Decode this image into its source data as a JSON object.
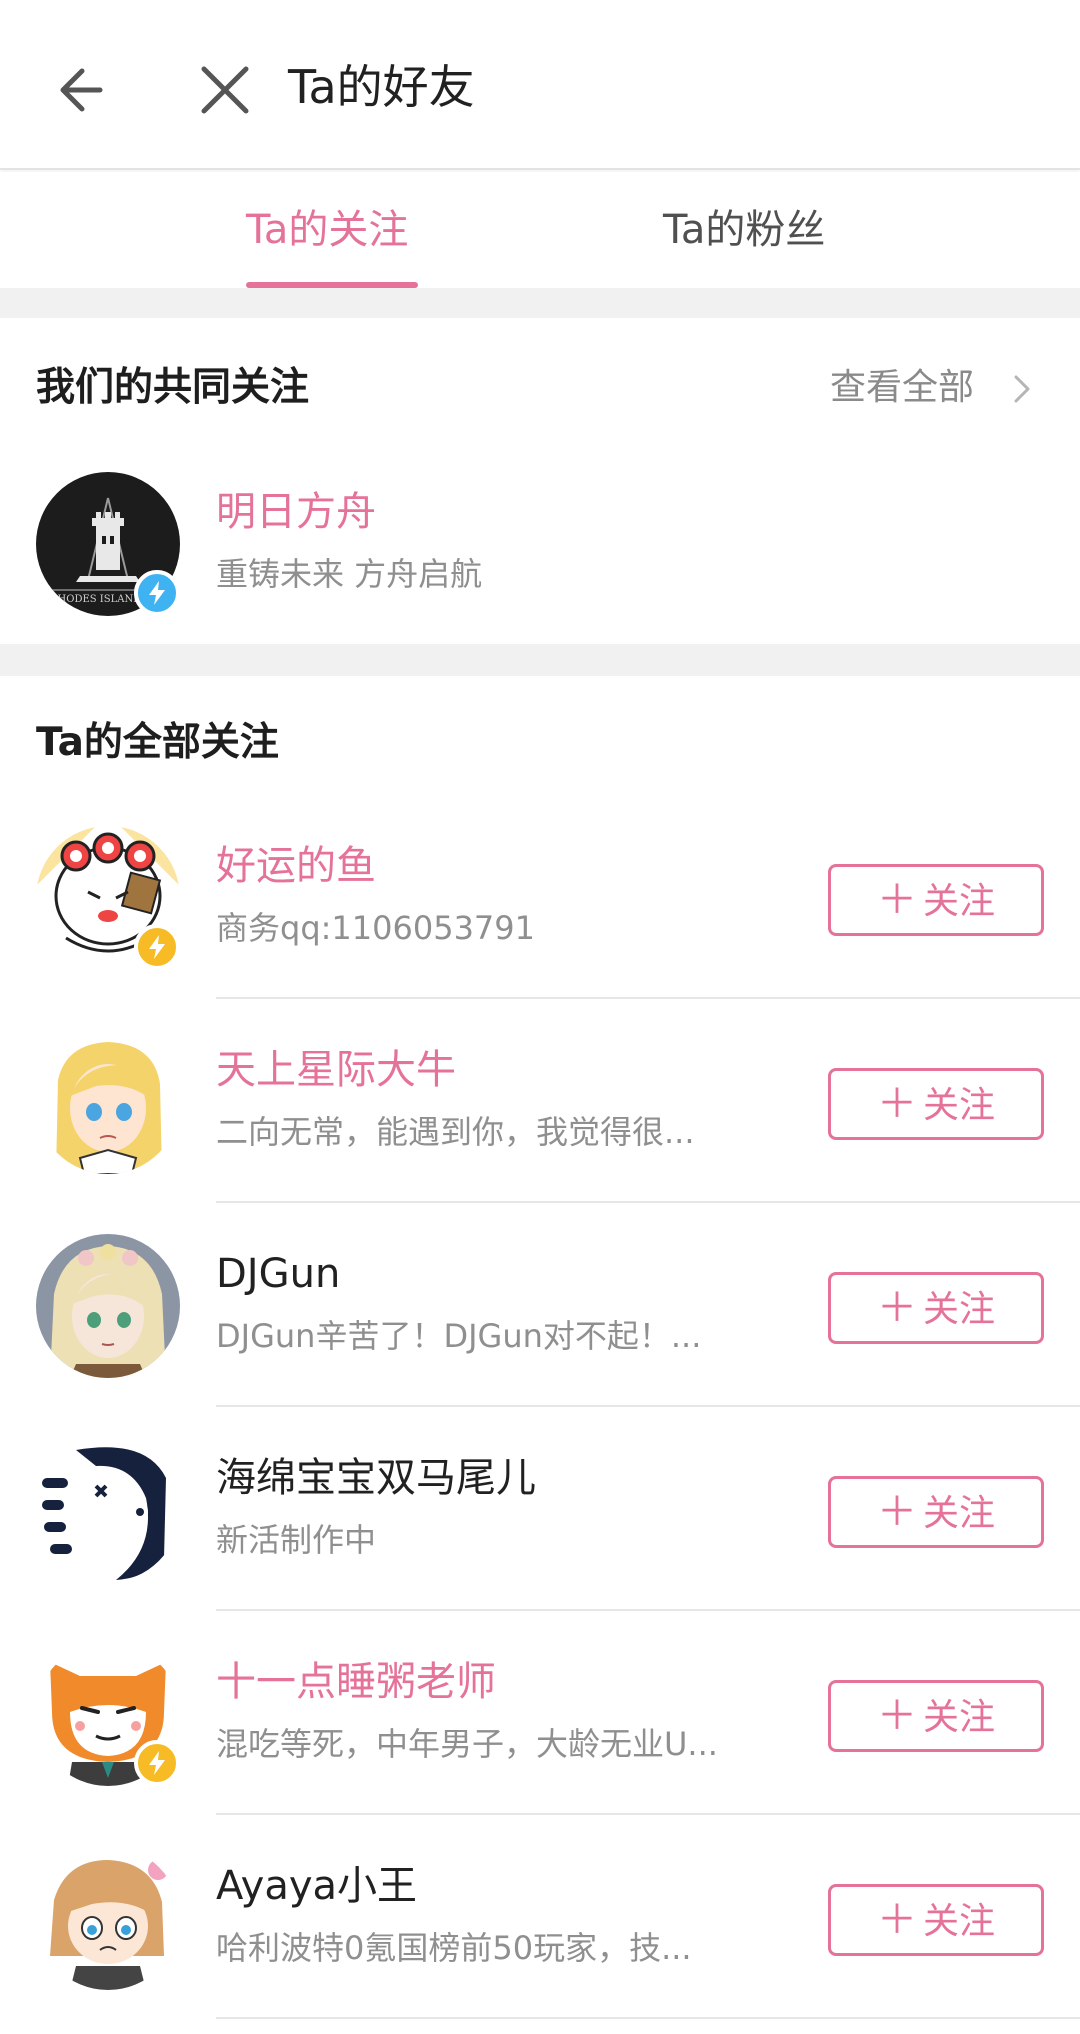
{
  "header": {
    "title": "Ta的好友"
  },
  "tabs": [
    {
      "label": "Ta的关注"
    },
    {
      "label": "Ta的粉丝"
    }
  ],
  "mutual": {
    "title": "我们的共同关注",
    "see_all": "查看全部",
    "user": {
      "name": "明日方舟",
      "desc": "重铸未来 方舟启航",
      "avatar_text": "RHODES ISLAND"
    }
  },
  "all": {
    "title": "Ta的全部关注",
    "follow_plus": "＋",
    "follow_label": "关注",
    "users": [
      {
        "name": "好运的鱼",
        "desc": "商务qq:1106053791"
      },
      {
        "name": "天上星际大牛",
        "desc": "二向无常，能遇到你，我觉得很..."
      },
      {
        "name": "DJGun",
        "desc": "DJGun辛苦了！DJGun对不起！..."
      },
      {
        "name": "海绵宝宝双马尾儿",
        "desc": "新活制作中"
      },
      {
        "name": "十一点睡粥老师",
        "desc": "混吃等死，中年男子，大龄无业U..."
      },
      {
        "name": "Ayaya小王",
        "desc": "哈利波特0氪国榜前50玩家，技..."
      }
    ]
  },
  "colors": {
    "accent": "#e57399",
    "badge_blue": "#3fb2f2",
    "badge_yellow": "#f7bb25"
  }
}
